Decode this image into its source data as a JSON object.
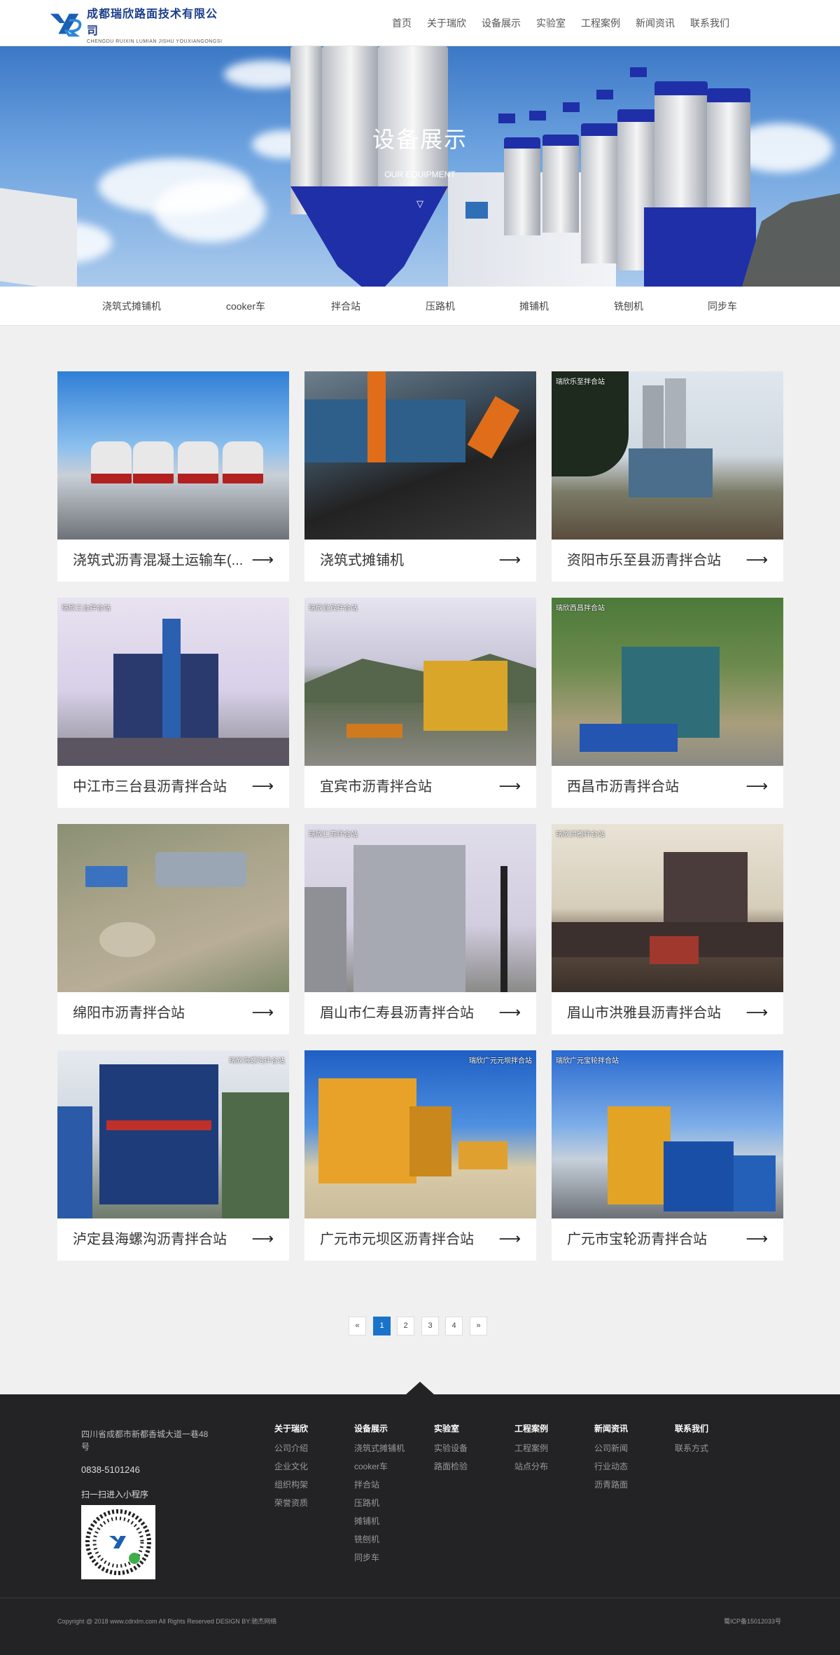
{
  "header": {
    "logo_cn": "成都瑞欣路面技术有限公司",
    "logo_en": "CHENGDU RUIXIN LUMIAN JISHU YOUXIANGONGSI",
    "nav": [
      "首页",
      "关于瑞欣",
      "设备展示",
      "实验室",
      "工程案例",
      "新闻资讯",
      "联系我们"
    ]
  },
  "banner": {
    "title": "设备展示",
    "subtitle": "OUR EQUIPMENT",
    "arrow": "▽"
  },
  "subnav": [
    "浇筑式摊铺机",
    "cooker车",
    "拌合站",
    "压路机",
    "摊铺机",
    "铣刨机",
    "同步车"
  ],
  "cards": [
    {
      "title": "浇筑式沥青混凝土运输车(...",
      "tag": ""
    },
    {
      "title": "浇筑式摊铺机",
      "tag": ""
    },
    {
      "title": "资阳市乐至县沥青拌合站",
      "tag": "瑞欣乐至拌合站"
    },
    {
      "title": "中江市三台县沥青拌合站",
      "tag": "瑞欣三台拌合站"
    },
    {
      "title": "宜宾市沥青拌合站",
      "tag": "瑞欣宜宾拌合站"
    },
    {
      "title": "西昌市沥青拌合站",
      "tag": "瑞欣西昌拌合站"
    },
    {
      "title": "绵阳市沥青拌合站",
      "tag": ""
    },
    {
      "title": "眉山市仁寿县沥青拌合站",
      "tag": "瑞欣仁寿拌合站"
    },
    {
      "title": "眉山市洪雅县沥青拌合站",
      "tag": "瑞欣洪雅拌合站"
    },
    {
      "title": "泸定县海螺沟沥青拌合站",
      "tag": "瑞欣海螺沟拌合站"
    },
    {
      "title": "广元市元坝区沥青拌合站",
      "tag": "瑞欣广元元坝拌合站"
    },
    {
      "title": "广元市宝轮沥青拌合站",
      "tag": "瑞欣广元宝轮拌合站"
    }
  ],
  "card_arrow": "⟶",
  "pagination": {
    "prev": "«",
    "pages": [
      "1",
      "2",
      "3",
      "4"
    ],
    "next": "»",
    "current": "1"
  },
  "footer": {
    "address": "四川省成都市新都香城大道一巷48号",
    "phone": "0838-5101246",
    "qr_label": "扫一扫进入小程序",
    "columns": [
      {
        "title": "关于瑞欣",
        "links": [
          "公司介绍",
          "企业文化",
          "组织构架",
          "荣誉资质"
        ]
      },
      {
        "title": "设备展示",
        "links": [
          "浇筑式摊铺机",
          "cooker车",
          "拌合站",
          "压路机",
          "摊铺机",
          "铣刨机",
          "同步车"
        ]
      },
      {
        "title": "实验室",
        "links": [
          "实验设备",
          "路面检验"
        ]
      },
      {
        "title": "工程案例",
        "links": [
          "工程案例",
          "站点分布"
        ]
      },
      {
        "title": "新闻资讯",
        "links": [
          "公司新闻",
          "行业动态",
          "沥青路面"
        ]
      },
      {
        "title": "联系我们",
        "links": [
          "联系方式"
        ]
      }
    ],
    "copyright": "Copyright @ 2018 www.cdrxlm.com All Rights Reserved    DESIGN BY:驰杰网络",
    "icp": "蜀ICP备15012033号"
  }
}
